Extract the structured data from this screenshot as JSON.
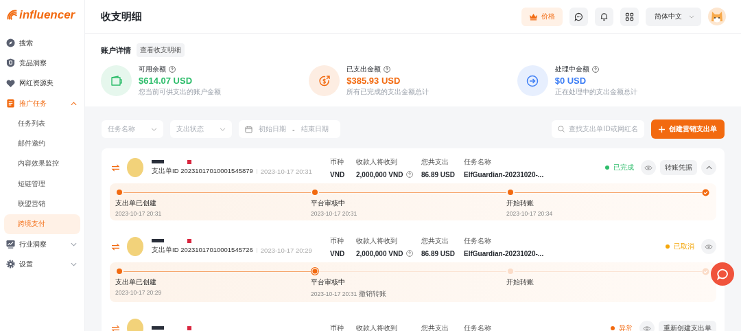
{
  "logo": {
    "text": "influencer"
  },
  "sidebar": {
    "items": [
      {
        "label": "搜索",
        "selected": false
      },
      {
        "label": "竞品洞察",
        "selected": false
      },
      {
        "label": "网红资源夹",
        "selected": false
      },
      {
        "label": "推广任务",
        "selected": false,
        "expanded": true,
        "children": [
          {
            "label": "任务列表",
            "selected": false
          },
          {
            "label": "邮件邀约",
            "selected": false
          },
          {
            "label": "内容效果监控",
            "selected": false
          },
          {
            "label": "短链管理",
            "selected": false
          },
          {
            "label": "联盟营销",
            "selected": false
          },
          {
            "label": "跨境支付",
            "selected": true
          }
        ]
      },
      {
        "label": "行业洞察",
        "selected": false,
        "expanded": false
      },
      {
        "label": "设置",
        "selected": false,
        "expanded": false
      }
    ]
  },
  "header": {
    "title": "收支明细",
    "price_button": "价格",
    "language": "简体中文"
  },
  "account": {
    "title": "账户详情",
    "link": "查看收支明细",
    "stats": [
      {
        "kind": "wallet",
        "label": "可用余额",
        "amount": "$614.07 USD",
        "desc": "您当前可供支出的账户金额",
        "color": "#2ebd6b"
      },
      {
        "kind": "paid",
        "label": "已支出金额",
        "amount": "$385.93 USD",
        "desc": "所有已完成的支出金额总计",
        "color": "#f26a10"
      },
      {
        "kind": "processing",
        "label": "处理中金额",
        "amount": "$0 USD",
        "desc": "正在处理中的支出金额总计",
        "color": "#3d7ef5"
      }
    ]
  },
  "filters": {
    "task_placeholder": "任务名称",
    "status_placeholder": "支出状态",
    "start_placeholder": "初始日期",
    "separator": "-",
    "end_placeholder": "结束日期",
    "search_placeholder": "查找支出单ID或网红名",
    "create_button": "创建营销支出单"
  },
  "orders": [
    {
      "order_id": "支出单ID 20231017010001545879",
      "created": "2023-10-17 20:31",
      "currency_label": "币种",
      "currency": "VND",
      "receive_label": "收款人将收到",
      "receive": "2,000,000 VND",
      "paid_label": "您共支出",
      "paid": "86.89 USD",
      "task_label": "任务名称",
      "task": "ElfGuardian-20231020-...",
      "status": "已完成",
      "color": "#2ebd6b",
      "action": "转账凭据",
      "expanded": true,
      "steps": [
        {
          "label": "支出单已创建",
          "time": "2023-10-17 20:31",
          "completed": true,
          "active": false
        },
        {
          "label": "平台审核中",
          "time": "2023-10-17 20:31",
          "completed": true,
          "active": false
        },
        {
          "label": "开始转账",
          "time": "2023-10-17 20:34",
          "completed": true,
          "active": false
        }
      ],
      "end_completed": true
    },
    {
      "order_id": "支出单ID 20231017010001545726",
      "created": "2023-10-17 20:29",
      "currency_label": "币种",
      "currency": "VND",
      "receive_label": "收款人将收到",
      "receive": "2,000,000 VND",
      "paid_label": "您共支出",
      "paid": "86.89 USD",
      "task_label": "任务名称",
      "task": "ElfGuardian-20231020-...",
      "status": "已取消",
      "color": "#f5a70a",
      "steps": [
        {
          "label": "支出单已创建",
          "time": "2023-10-17 20:29",
          "completed": true,
          "active": false
        },
        {
          "label": "平台审核中",
          "time": "2023-10-17 20:31",
          "note": "撤销转账",
          "completed": false,
          "active": true
        },
        {
          "label": "开始转账",
          "completed": false,
          "active": false
        }
      ],
      "end_completed": false
    },
    {
      "currency_label": "币种",
      "receive_label": "收款人将收到",
      "paid_label": "您共支出",
      "task_label": "任务名称",
      "status": "异常",
      "color": "#f26a10",
      "action": "重新创建支出单"
    }
  ]
}
